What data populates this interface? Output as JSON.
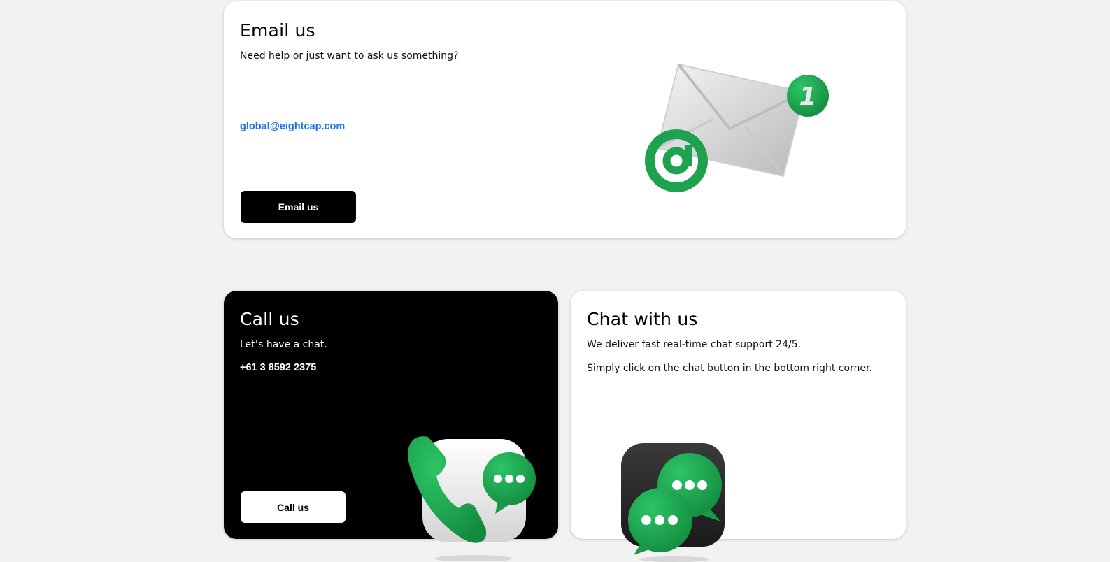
{
  "email_card": {
    "title": "Email us",
    "subtitle": "Need help or just want to ask us something?",
    "email": "global@eightcap.com",
    "button_label": "Email us",
    "badge_count": "1"
  },
  "call_card": {
    "title": "Call us",
    "subtitle": "Let’s have a chat.",
    "phone": "+61 3 8592 2375",
    "button_label": "Call us"
  },
  "chat_card": {
    "title": "Chat with us",
    "line1": "We deliver fast real-time chat support 24/5.",
    "line2": "Simply click on the chat button in the bottom right corner."
  },
  "colors": {
    "page_background": "#f2f2f2",
    "accent_green": "#1fa24f",
    "link_blue": "#1a73e8",
    "dark_card": "#000000"
  },
  "icons": [
    "envelope-icon",
    "at-sign-icon",
    "notification-badge-icon",
    "phone-icon",
    "chat-bubble-icon"
  ]
}
